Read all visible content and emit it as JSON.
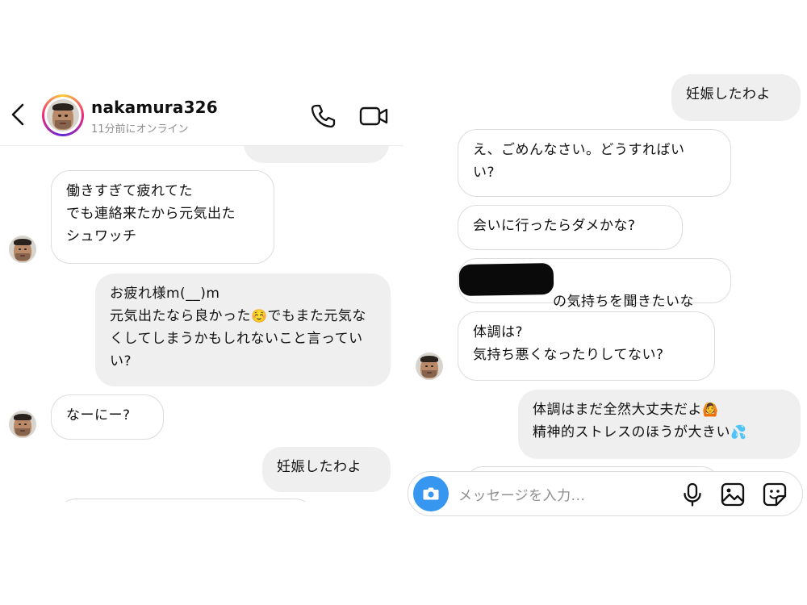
{
  "left_panel": {
    "header": {
      "back_icon": "chevron-left-icon",
      "username": "nakamura326",
      "status": "11分前にオンライン",
      "call_icon": "phone-icon",
      "video_icon": "video-camera-icon"
    },
    "messages": [
      {
        "type": "received",
        "text": "働きすぎて疲れてた\nでも連絡来たから元気出た\nシュワッチ"
      },
      {
        "type": "sent",
        "text_before_emoji": "お疲れ様m(__)m\n元気出たなら良かった",
        "emoji": "☺️",
        "text_after_emoji": "でもまた元気なくしてしまうかもしれないこと言っていい?"
      },
      {
        "type": "received",
        "text": "なーにー?"
      },
      {
        "type": "sent",
        "text": "妊娠したわよ"
      }
    ]
  },
  "right_panel": {
    "messages": [
      {
        "type": "sent",
        "text": "妊娠したわよ"
      },
      {
        "type": "received",
        "text": "え、ごめんなさい。どうすればい\nい?"
      },
      {
        "type": "received",
        "text": "会いに行ったらダメかな?"
      },
      {
        "type": "received",
        "text": "の気持ちを聞きたいな",
        "redacted": true
      },
      {
        "type": "received",
        "text": "体調は?\n気持ち悪くなったりしてない?"
      },
      {
        "type": "sent",
        "line1": "体調はまだ全然大丈夫だよ",
        "emoji1": "🙆",
        "line2": "精神的ストレスのほうが大きい",
        "emoji2": "💦"
      }
    ],
    "composer": {
      "camera_icon": "camera-icon",
      "placeholder": "メッセージを入力...",
      "mic_icon": "microphone-icon",
      "gallery_icon": "image-icon",
      "sticker_icon": "sticker-icon"
    }
  },
  "colors": {
    "accent": "#3797f0",
    "sent_bubble": "#efefef",
    "received_border": "#dcdcdc"
  }
}
